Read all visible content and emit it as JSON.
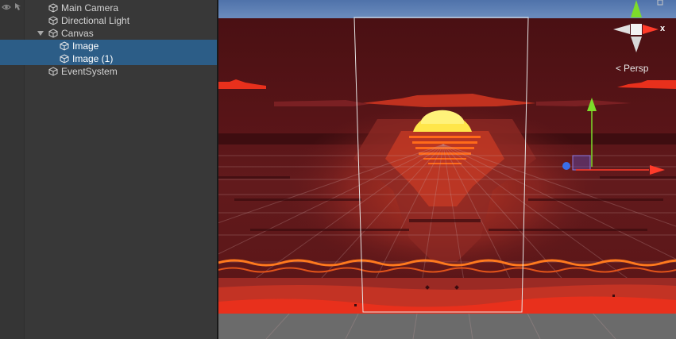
{
  "hierarchy": {
    "items": [
      {
        "label": "Main Camera",
        "selected": false
      },
      {
        "label": "Directional Light",
        "selected": false
      },
      {
        "label": "Canvas",
        "selected": false,
        "expanded": true
      },
      {
        "label": "Image",
        "selected": true
      },
      {
        "label": "Image (1)",
        "selected": true
      },
      {
        "label": "EventSystem",
        "selected": false
      }
    ],
    "gutter_icons": [
      "eye-icon",
      "hand-pointer-icon"
    ]
  },
  "scene": {
    "projection_label": "Persp",
    "gizmo_axis_label": "x",
    "colors": {
      "sky": "#5e7fb1",
      "background": "#4b1216",
      "sun": "#ffe64a",
      "orange": "#ff6a1a",
      "red": "#e8301c",
      "selection": "#2c5d87",
      "axis_x": "#ff3b2a",
      "axis_y": "#7ddc2a",
      "axis_z": "#3a6ee8"
    }
  }
}
